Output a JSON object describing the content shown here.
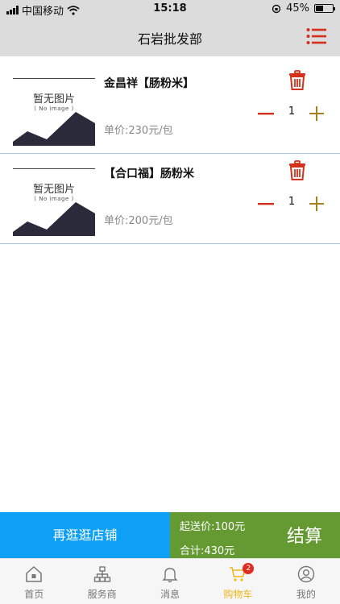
{
  "status_bar": {
    "carrier": "中国移动",
    "time": "15:18",
    "battery": "45%"
  },
  "header": {
    "title": "石岩批发部"
  },
  "placeholder_image": {
    "title": "暂无图片",
    "subtitle": "( No image )"
  },
  "cart": {
    "items": [
      {
        "name": "金昌祥【肠粉米】",
        "price": "单价:230元/包",
        "quantity": "1"
      },
      {
        "name": "【合口福】肠粉米",
        "price": "单价:200元/包",
        "quantity": "1"
      }
    ]
  },
  "footer": {
    "continue_label": "再逛逛店铺",
    "min_delivery": "起送价:100元",
    "total": "合计:430元",
    "checkout_label": "结算"
  },
  "tabs": [
    {
      "label": "首页",
      "icon": "home-icon"
    },
    {
      "label": "服务商",
      "icon": "network-icon"
    },
    {
      "label": "消息",
      "icon": "bell-icon"
    },
    {
      "label": "购物车",
      "icon": "cart-icon",
      "active": true,
      "badge": "2"
    },
    {
      "label": "我的",
      "icon": "user-icon"
    }
  ],
  "colors": {
    "accent_red": "#d5301c",
    "plus_gold": "#a6801c",
    "continue_blue": "#0ea0f5",
    "checkout_green": "#659a33",
    "tab_active": "#f0b71d"
  }
}
